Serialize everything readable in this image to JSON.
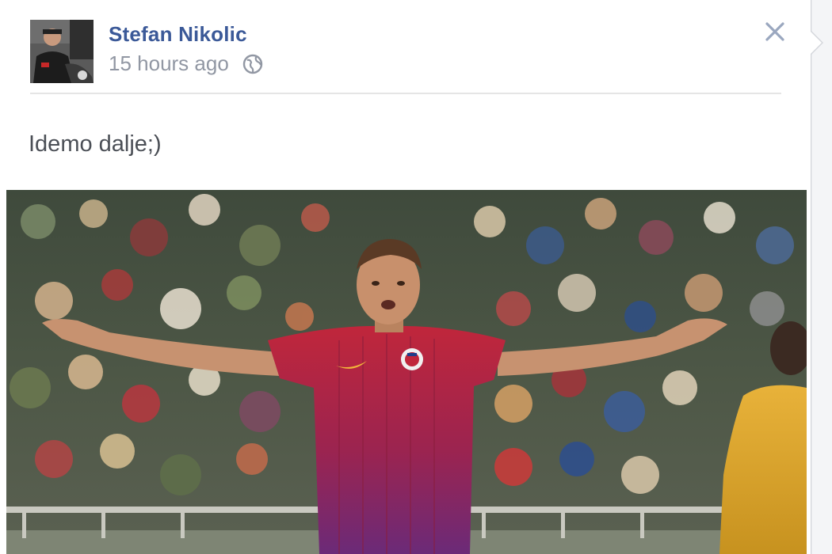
{
  "post": {
    "author": {
      "name": "Stefan Nikolic"
    },
    "timestamp": "15 hours ago",
    "privacy_icon": "globe-icon",
    "close_icon": "close-icon",
    "status_text": "Idemo dalje;)",
    "photo": {
      "subject": "football-player-celebrating",
      "jersey_color": "#b0233a"
    }
  },
  "colors": {
    "author_link": "#3b5998",
    "timestamp": "#9197a3",
    "close_icon": "#9aa7bf"
  }
}
